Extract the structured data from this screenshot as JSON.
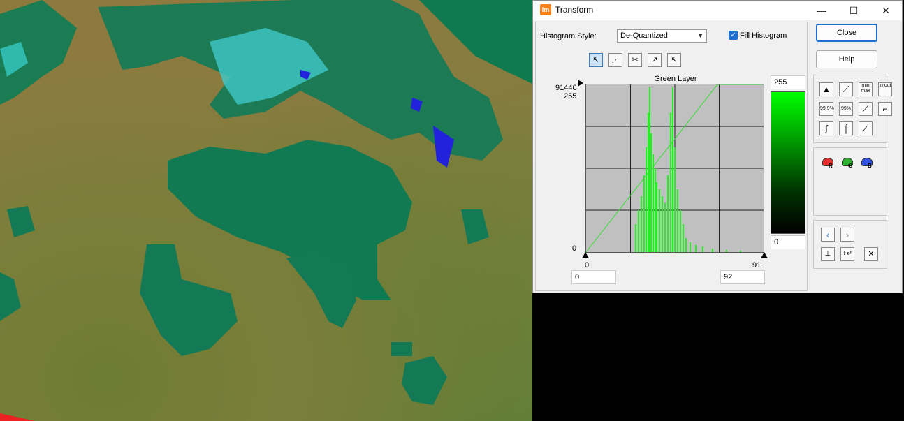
{
  "window": {
    "title": "Transform",
    "app_icon": "Im"
  },
  "controls": {
    "minimize": "—",
    "maximize": "☐",
    "close": "✕"
  },
  "histogram_style": {
    "label": "Histogram Style:",
    "value": "De-Quantized"
  },
  "fill_histogram": {
    "label": "Fill Histogram",
    "checked": true
  },
  "tools": [
    "select-arrow-icon",
    "node-edit-icon",
    "cut-node-icon",
    "add-curve-icon",
    "remove-curve-icon"
  ],
  "histogram": {
    "title": "Green Layer",
    "y_count_max": "91440",
    "y_value_max": "255",
    "y_min": "0",
    "x_min": "0",
    "x_max": "91",
    "input_min": "0",
    "input_max": "92",
    "output_max": "255",
    "output_min": "0",
    "curve_color": "#33dd33"
  },
  "buttons": {
    "close": "Close",
    "help": "Help"
  },
  "presets": {
    "row1": [
      "auto-icon",
      "linear-icon",
      "min/max",
      "in/out"
    ],
    "row1_text": [
      "",
      "",
      "min max",
      "in out"
    ],
    "row2_text": [
      "99.9%",
      "99%",
      "",
      ""
    ],
    "row3_text": [
      "",
      "",
      ""
    ]
  },
  "channels": [
    "R",
    "G",
    "B"
  ],
  "channel_colors": [
    "#e53030",
    "#30b030",
    "#3050e0"
  ],
  "image": {
    "accent_water": "#857a3c",
    "accent_land": "#1a7a4a",
    "accent_urban": "#30e0e0"
  }
}
